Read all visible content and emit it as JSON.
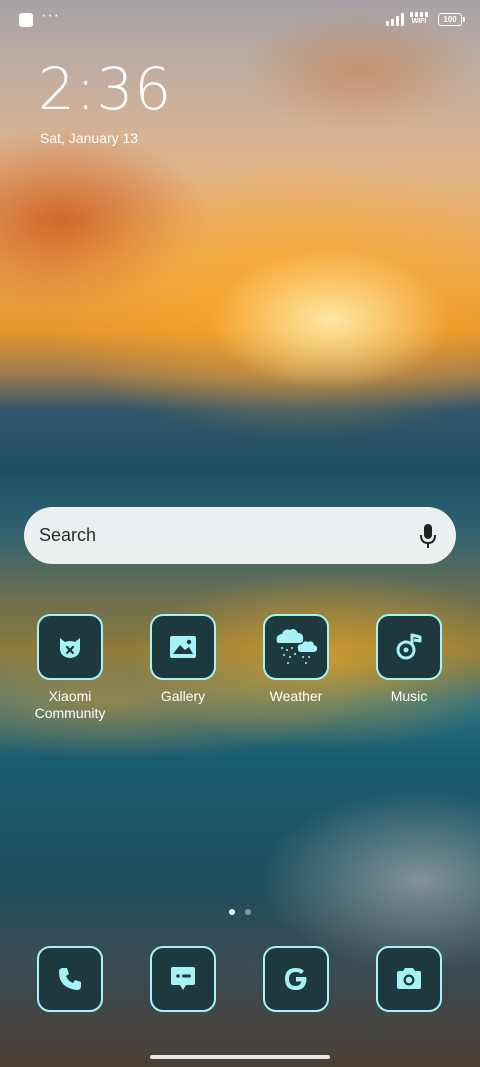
{
  "status_bar": {
    "battery": "100",
    "wifi_label": "WIFI",
    "notification_dots": "···"
  },
  "lockscreen": {
    "time": "2:36",
    "date": "Sat, January 13"
  },
  "search": {
    "placeholder": "Search"
  },
  "apps": [
    {
      "label": "Xiaomi\nCommunity",
      "icon": "xiaomi-community-icon"
    },
    {
      "label": "Gallery",
      "icon": "gallery-icon"
    },
    {
      "label": "Weather",
      "icon": "weather-icon"
    },
    {
      "label": "Music",
      "icon": "music-icon"
    }
  ],
  "dock": [
    {
      "icon": "phone-icon"
    },
    {
      "icon": "messages-icon"
    },
    {
      "icon": "google-icon"
    },
    {
      "icon": "camera-icon"
    }
  ],
  "page_indicator": {
    "pages": 2,
    "current": 1
  },
  "colors": {
    "icon_bg": "#1f3a3f",
    "icon_accent": "#a6f2f5"
  }
}
